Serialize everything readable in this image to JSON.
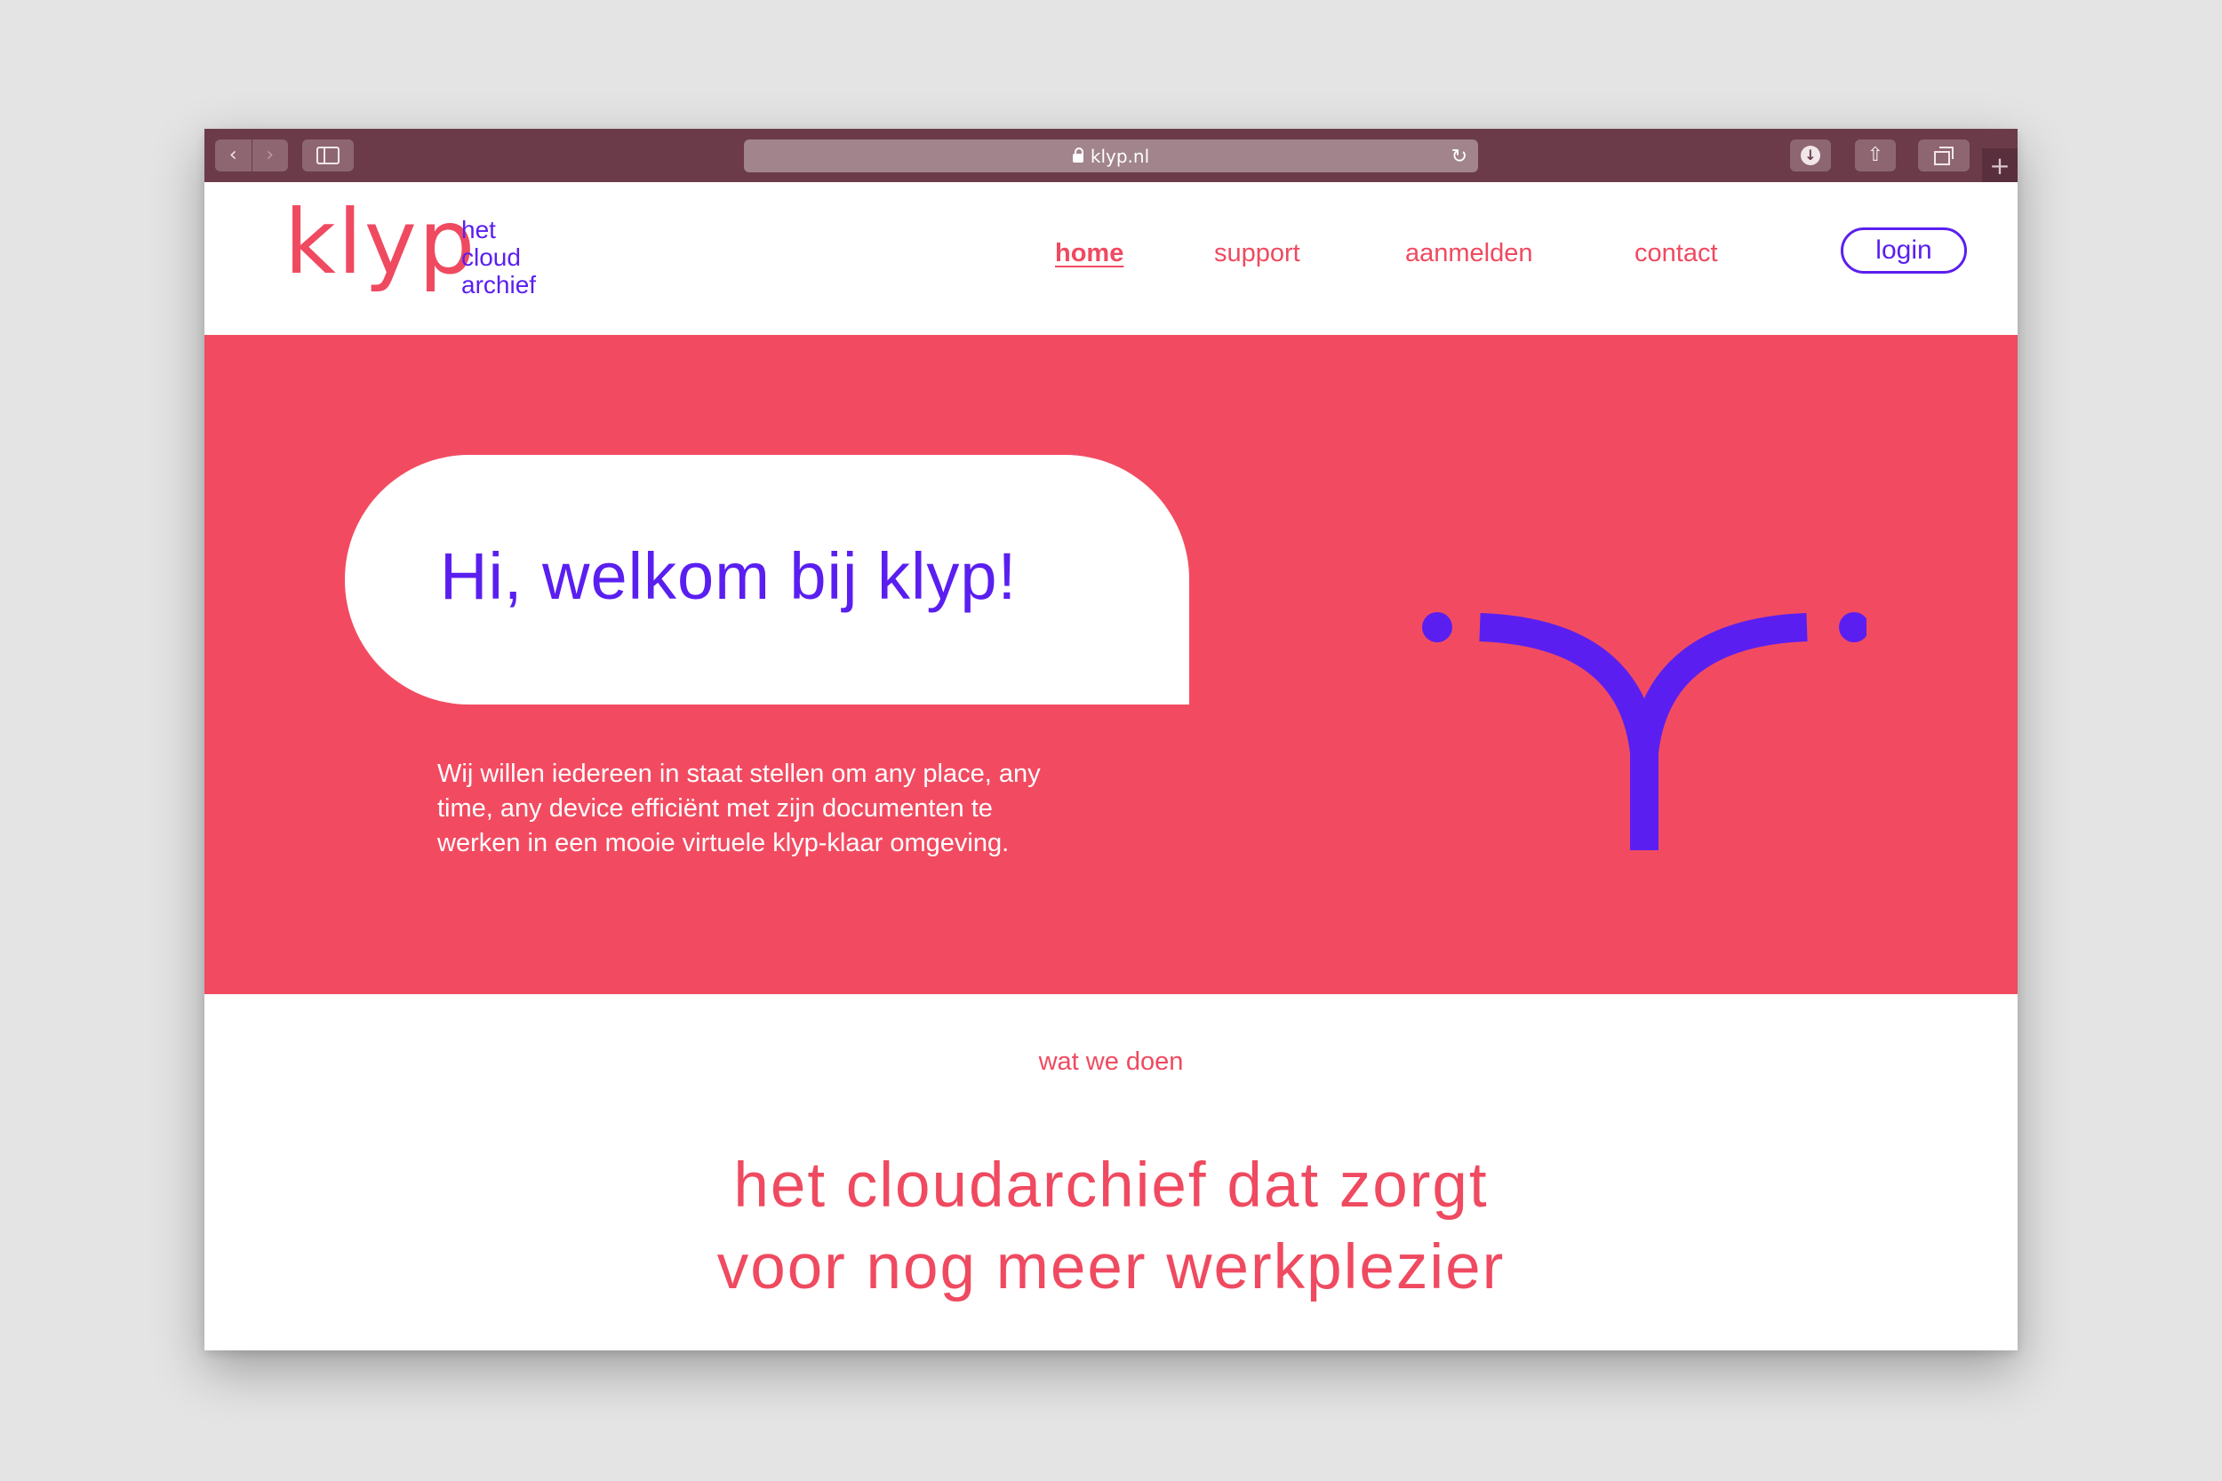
{
  "browser": {
    "url": "klyp.nl",
    "back_icon": "chevron-left-icon",
    "forward_icon": "chevron-right-icon",
    "sidebar_icon": "sidebar-icon",
    "lock_icon": "lock-icon",
    "reload_icon": "reload-icon",
    "download_icon": "download-icon",
    "share_icon": "share-icon",
    "tabs_icon": "tabs-icon",
    "new_tab_icon": "plus-icon",
    "chrome_color": "#6b3b4a"
  },
  "header": {
    "logo": "klyp",
    "tagline": [
      "het",
      "cloud",
      "archief"
    ],
    "nav": [
      {
        "label": "home",
        "active": true
      },
      {
        "label": "support",
        "active": false
      },
      {
        "label": "aanmelden",
        "active": false
      },
      {
        "label": "contact",
        "active": false
      }
    ],
    "login_label": "login"
  },
  "hero": {
    "title": "Hi, welkom bij klyp!",
    "text_lines": [
      "Wij willen iedereen in staat stellen om any place, any",
      "time, any device efficiënt met zijn documenten te",
      "werken in een mooie virtuele klyp-klaar omgeving."
    ],
    "mascot_icon": "klyp-y-face-icon",
    "background_color": "#f24b61"
  },
  "section": {
    "label": "wat we doen",
    "heading_lines": [
      "het cloudarchief dat zorgt",
      "voor nog meer werkplezier"
    ]
  },
  "colors": {
    "brand_pink": "#ef4a60",
    "brand_purple": "#5a1ff0",
    "white": "#ffffff"
  }
}
